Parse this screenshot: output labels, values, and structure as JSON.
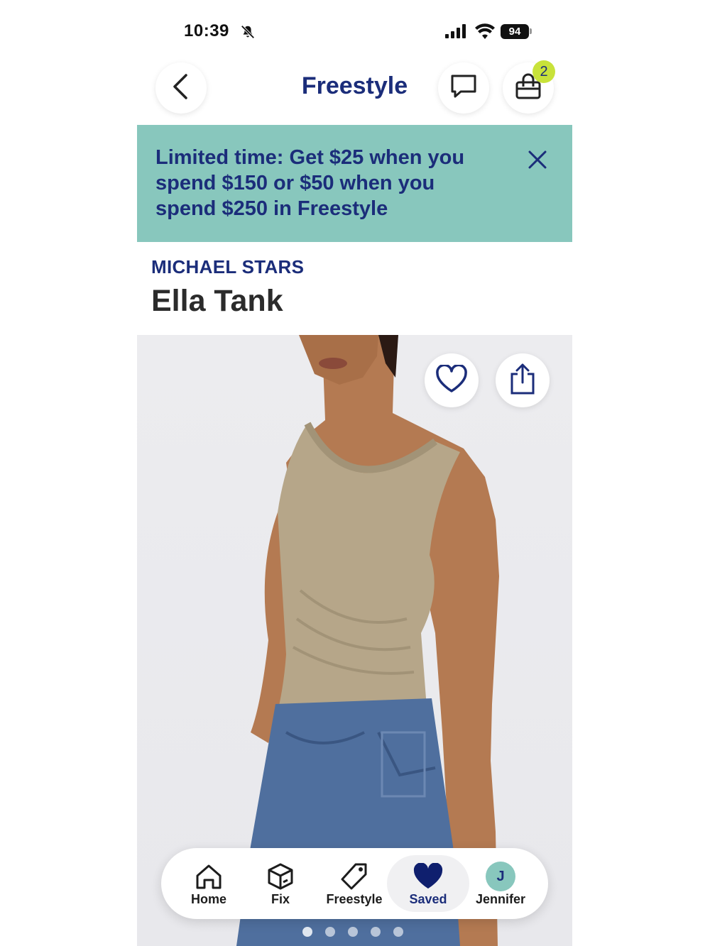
{
  "status_bar": {
    "time": "10:39",
    "battery": "94",
    "icons": [
      "bell-off-icon",
      "signal-icon",
      "wifi-icon",
      "battery-icon"
    ]
  },
  "header": {
    "title": "Freestyle",
    "cart_count": "2",
    "icons": [
      "back-chevron-icon",
      "chat-icon",
      "shopping-bag-icon"
    ]
  },
  "promo": {
    "line1": "Limited time: Get $25 when you",
    "line2": "spend $150 or $50 when you",
    "line3": "spend $250 in Freestyle",
    "background": "#88c7bd"
  },
  "product": {
    "brand": "MICHAEL STARS",
    "name": "Ella Tank",
    "image_actions": [
      "heart-icon",
      "share-icon"
    ]
  },
  "tab_bar": {
    "items": [
      {
        "label": "Home",
        "icon": "home-icon"
      },
      {
        "label": "Fix",
        "icon": "box-icon"
      },
      {
        "label": "Freestyle",
        "icon": "tag-icon"
      },
      {
        "label": "Saved",
        "icon": "heart-filled-icon",
        "active": true
      },
      {
        "label": "Jennifer",
        "icon": "avatar",
        "initial": "J"
      }
    ]
  },
  "colors": {
    "brand_navy": "#1b2d7a",
    "promo_teal": "#88c7bd",
    "badge_lime": "#c8e23a"
  }
}
